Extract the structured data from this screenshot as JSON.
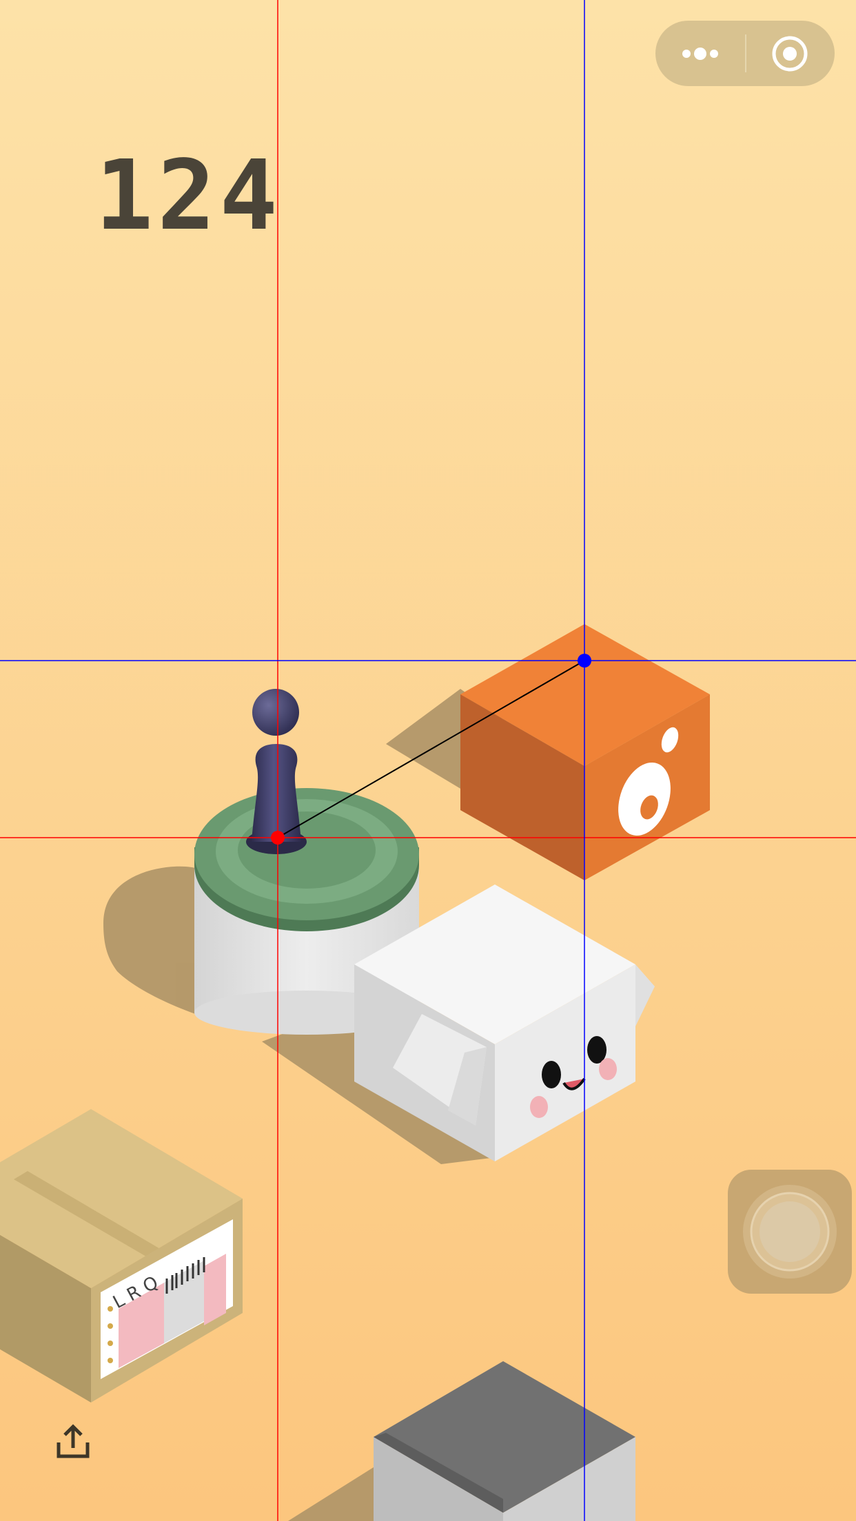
{
  "score": "124",
  "crate_label": "L R Q",
  "icons": {
    "menu": "more-dots-icon",
    "close": "target-circle-icon",
    "share": "share-icon"
  },
  "colors": {
    "background_top": "#fde2a8",
    "background_bottom": "#fcc77f",
    "score_text": "#4a4438",
    "orange_cube": "#f08237",
    "green_top": "#6a9a70",
    "player": "#3e3d63",
    "guide_red": "#ff0000",
    "guide_blue": "#0000ff"
  }
}
